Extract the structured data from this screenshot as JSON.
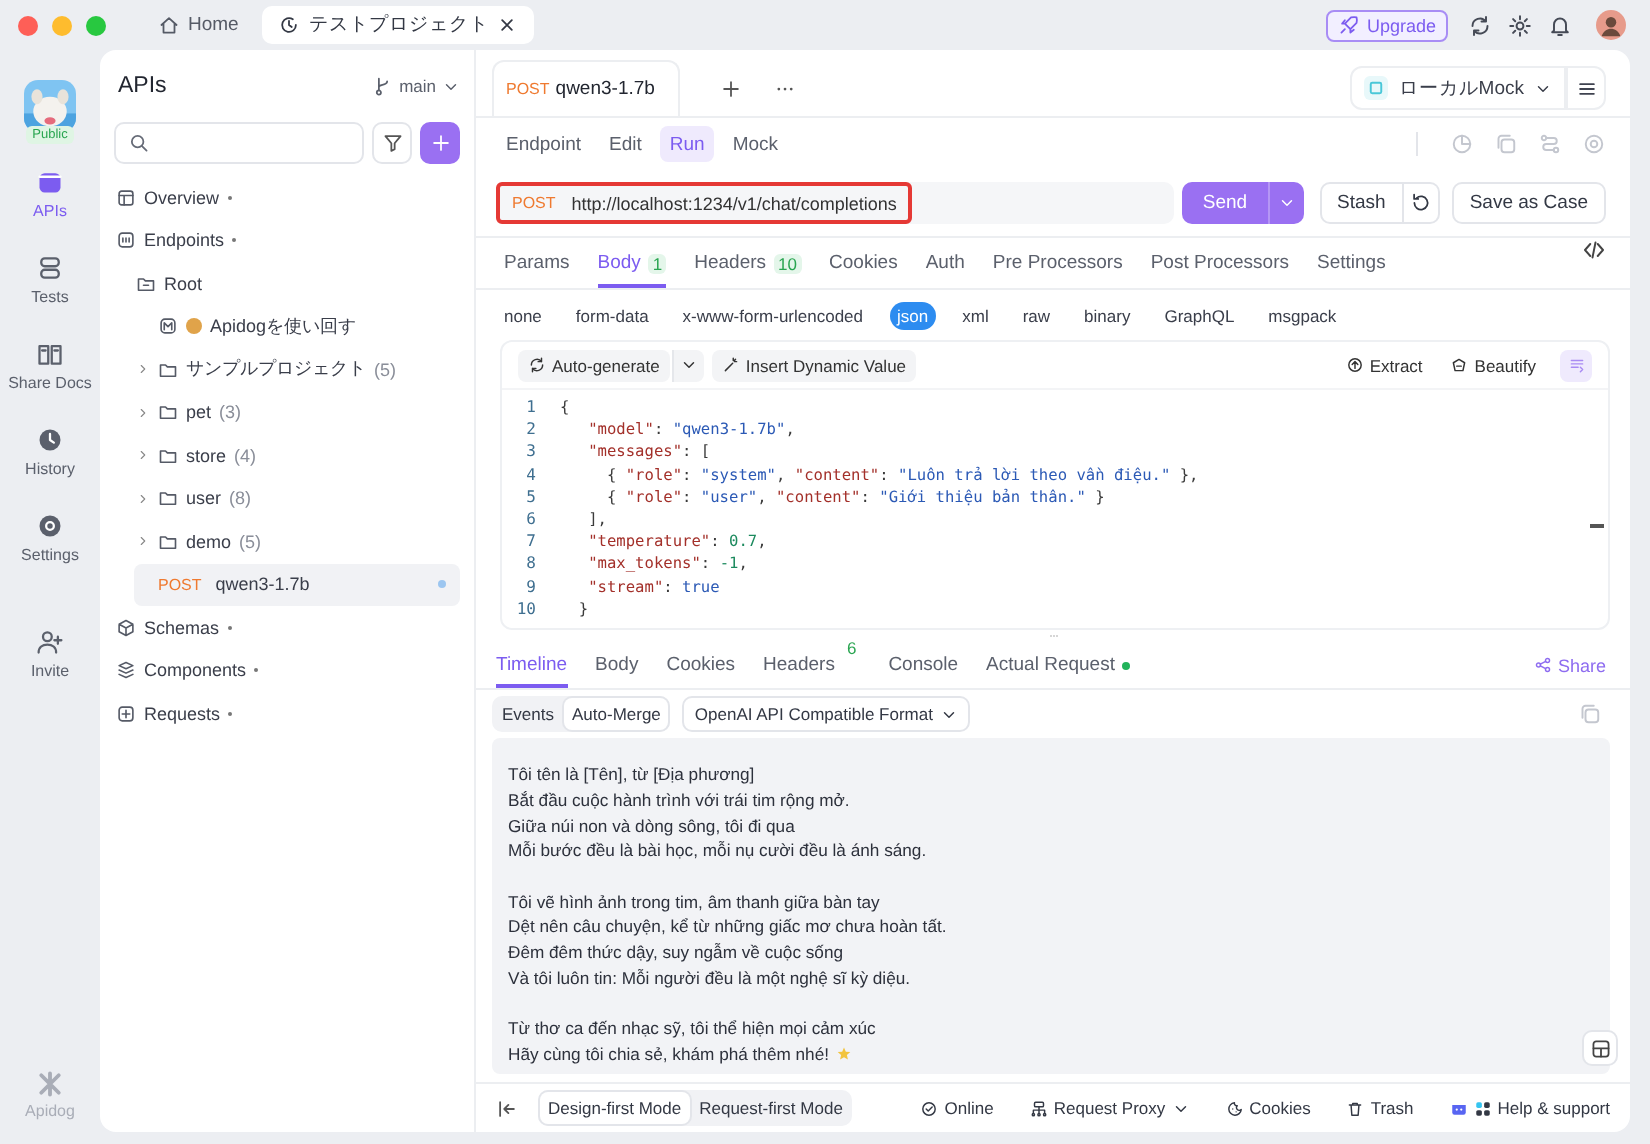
{
  "titlebar": {
    "tabs": [
      {
        "kind": "home",
        "label": "Home",
        "selected": false
      },
      {
        "kind": "project",
        "label": "テストプロジェクト",
        "selected": true
      }
    ],
    "upgrade": "Upgrade"
  },
  "rail": {
    "badge": "Public",
    "items": [
      {
        "kind": "apis",
        "label": "APIs",
        "selected": true
      },
      {
        "kind": "tests",
        "label": "Tests",
        "selected": false
      },
      {
        "kind": "docs",
        "label": "Share Docs",
        "selected": false
      },
      {
        "kind": "history",
        "label": "History",
        "selected": false
      },
      {
        "kind": "settings",
        "label": "Settings",
        "selected": false
      }
    ],
    "extra_items": [
      {
        "kind": "invite",
        "label": "Invite",
        "selected": false
      }
    ],
    "brand": "Apidog"
  },
  "sidebar": {
    "title": "APIs",
    "branch": "main",
    "tree": [
      {
        "kind": "overview",
        "label": "Overview",
        "selected": false
      },
      {
        "kind": "endpoints",
        "label": "Endpoints",
        "selected": false,
        "children": [
          {
            "kind": "root",
            "label": "Root",
            "selected": false,
            "children": [
              {
                "kind": "doc",
                "label": "Apidogを使い回す",
                "selected": false,
                "modified": false
              },
              {
                "kind": "folder",
                "label": "サンプルプロジェクト",
                "count": "(5)",
                "expanded": false,
                "selected": false,
                "modified": false
              },
              {
                "kind": "folder",
                "label": "pet",
                "count": "(3)",
                "expanded": false,
                "selected": false,
                "modified": false
              },
              {
                "kind": "folder",
                "label": "store",
                "count": "(4)",
                "expanded": false,
                "selected": false,
                "modified": false
              },
              {
                "kind": "folder",
                "label": "user",
                "count": "(8)",
                "expanded": false,
                "selected": false,
                "modified": false
              },
              {
                "kind": "folder",
                "label": "demo",
                "count": "(5)",
                "expanded": false,
                "selected": false,
                "modified": false
              },
              {
                "kind": "endpoint",
                "method": "POST",
                "label": "qwen3-1.7b",
                "selected": true,
                "modified": true
              }
            ]
          }
        ]
      },
      {
        "kind": "schemas",
        "label": "Schemas",
        "selected": false
      },
      {
        "kind": "components",
        "label": "Components",
        "selected": false
      },
      {
        "kind": "requests",
        "label": "Requests",
        "selected": false
      }
    ]
  },
  "main": {
    "open_tab": {
      "method": "POST",
      "name": "qwen3-1.7b"
    },
    "environment": "ローカルMock",
    "modes": [
      {
        "label": "Endpoint",
        "selected": false
      },
      {
        "label": "Edit",
        "selected": false
      },
      {
        "label": "Run",
        "selected": true
      },
      {
        "label": "Mock",
        "selected": false
      }
    ],
    "url": {
      "method": "POST",
      "value": "http://localhost:1234/v1/chat/completions"
    },
    "send": "Send",
    "stash": "Stash",
    "save": "Save as Case",
    "request_tabs": [
      {
        "label": "Params",
        "selected": false
      },
      {
        "label": "Body",
        "count": "1",
        "selected": true
      },
      {
        "label": "Headers",
        "count": "10",
        "selected": false
      },
      {
        "label": "Cookies",
        "selected": false
      },
      {
        "label": "Auth",
        "selected": false
      },
      {
        "label": "Pre Processors",
        "selected": false
      },
      {
        "label": "Post Processors",
        "selected": false
      },
      {
        "label": "Settings",
        "selected": false
      }
    ],
    "body_types": [
      {
        "label": "none",
        "selected": false
      },
      {
        "label": "form-data",
        "selected": false
      },
      {
        "label": "x-www-form-urlencoded",
        "selected": false
      },
      {
        "label": "json",
        "selected": true
      },
      {
        "label": "xml",
        "selected": false
      },
      {
        "label": "raw",
        "selected": false
      },
      {
        "label": "binary",
        "selected": false
      },
      {
        "label": "GraphQL",
        "selected": false
      },
      {
        "label": "msgpack",
        "selected": false
      }
    ],
    "editor": {
      "auto_generate": "Auto-generate",
      "insert": "Insert Dynamic Value",
      "extract": "Extract",
      "beautify": "Beautify",
      "lines": [
        {
          "number": "1",
          "tokens": [
            {
              "kind": "punct",
              "text": "{"
            }
          ]
        },
        {
          "number": "2",
          "tokens": [
            {
              "kind": "key",
              "text": "   \"model\""
            },
            {
              "kind": "punct",
              "text": ": "
            },
            {
              "kind": "str",
              "text": "\"qwen3-1.7b\""
            },
            {
              "kind": "punct",
              "text": ","
            }
          ]
        },
        {
          "number": "3",
          "tokens": [
            {
              "kind": "key",
              "text": "   \"messages\""
            },
            {
              "kind": "punct",
              "text": ": ["
            }
          ]
        },
        {
          "number": "4",
          "tokens": [
            {
              "kind": "punct",
              "text": "     { "
            },
            {
              "kind": "key",
              "text": "\"role\""
            },
            {
              "kind": "punct",
              "text": ": "
            },
            {
              "kind": "str",
              "text": "\"system\""
            },
            {
              "kind": "punct",
              "text": ", "
            },
            {
              "kind": "key",
              "text": "\"content\""
            },
            {
              "kind": "punct",
              "text": ": "
            },
            {
              "kind": "str",
              "text": "\"Luôn trả lời theo vần điệu.\""
            },
            {
              "kind": "punct",
              "text": " },"
            }
          ]
        },
        {
          "number": "5",
          "tokens": [
            {
              "kind": "punct",
              "text": "     { "
            },
            {
              "kind": "key",
              "text": "\"role\""
            },
            {
              "kind": "punct",
              "text": ": "
            },
            {
              "kind": "str",
              "text": "\"user\""
            },
            {
              "kind": "punct",
              "text": ", "
            },
            {
              "kind": "key",
              "text": "\"content\""
            },
            {
              "kind": "punct",
              "text": ": "
            },
            {
              "kind": "str",
              "text": "\"Giới thiệu bản thân.\""
            },
            {
              "kind": "punct",
              "text": " }"
            }
          ]
        },
        {
          "number": "6",
          "tokens": [
            {
              "kind": "punct",
              "text": "   ],"
            }
          ]
        },
        {
          "number": "7",
          "tokens": [
            {
              "kind": "key",
              "text": "   \"temperature\""
            },
            {
              "kind": "punct",
              "text": ": "
            },
            {
              "kind": "num",
              "text": "0.7"
            },
            {
              "kind": "punct",
              "text": ","
            }
          ]
        },
        {
          "number": "8",
          "tokens": [
            {
              "kind": "key",
              "text": "   \"max_tokens\""
            },
            {
              "kind": "punct",
              "text": ": "
            },
            {
              "kind": "num",
              "text": "-1"
            },
            {
              "kind": "punct",
              "text": ","
            }
          ]
        },
        {
          "number": "9",
          "tokens": [
            {
              "kind": "key",
              "text": "   \"stream\""
            },
            {
              "kind": "punct",
              "text": ": "
            },
            {
              "kind": "bool",
              "text": "true"
            }
          ]
        },
        {
          "number": "10",
          "tokens": [
            {
              "kind": "punct",
              "text": "  }"
            }
          ]
        }
      ]
    }
  },
  "response": {
    "tabs": [
      {
        "label": "Timeline",
        "selected": true,
        "indicator": false
      },
      {
        "label": "Body",
        "selected": false,
        "indicator": false
      },
      {
        "label": "Cookies",
        "selected": false,
        "indicator": false
      },
      {
        "label": "Headers",
        "count": "6",
        "selected": false,
        "indicator": false
      },
      {
        "label": "Console",
        "selected": false,
        "indicator": false
      },
      {
        "label": "Actual Request",
        "selected": false,
        "indicator": true
      }
    ],
    "share": "Share",
    "views": [
      {
        "label": "Events",
        "selected": false
      },
      {
        "label": "Auto-Merge",
        "selected": true
      }
    ],
    "format": "OpenAI API Compatible Format",
    "stanzas": [
      [
        "Tôi tên là [Tên], từ [Địa phương]",
        "Bắt đầu cuộc hành trình với trái tim rộng mở.",
        "Giữa núi non và dòng sông, tôi đi qua",
        "Mỗi bước đều là bài học, mỗi nụ cười đều là ánh sáng."
      ],
      [
        "Tôi vẽ hình ảnh trong tim, âm thanh giữa bàn tay",
        "Dệt nên câu chuyện, kể từ những giấc mơ chưa hoàn tất.",
        "Đêm đêm thức dậy, suy ngẫm về cuộc sống",
        "Và tôi luôn tin: Mỗi người đều là một nghệ sĩ kỳ diệu."
      ],
      [
        "Từ thơ ca đến nhạc sỹ, tôi thể hiện mọi cảm xúc",
        "Hãy cùng tôi chia sẻ, khám phá thêm nhé!"
      ]
    ]
  },
  "status_bar": {
    "modes": [
      {
        "label": "Design-first Mode",
        "selected": true
      },
      {
        "label": "Request-first Mode",
        "selected": false
      }
    ],
    "items": [
      {
        "kind": "online",
        "label": "Online"
      },
      {
        "kind": "proxy",
        "label": "Request Proxy"
      },
      {
        "kind": "cookies",
        "label": "Cookies"
      },
      {
        "kind": "trash",
        "label": "Trash"
      },
      {
        "kind": "help",
        "label": "Help & support"
      }
    ]
  }
}
